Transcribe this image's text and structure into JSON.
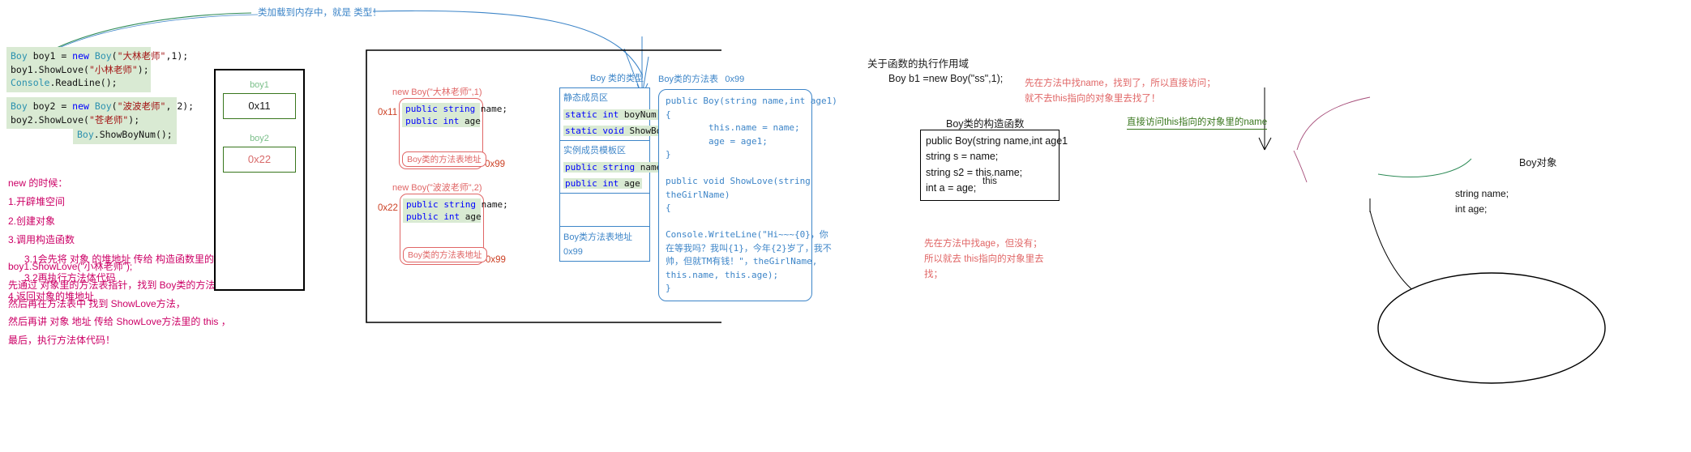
{
  "top_annotation": "类加载到内存中，就是 类型！",
  "left_code": {
    "block1": [
      {
        "parts": [
          {
            "t": "Boy",
            "c": "typ"
          },
          {
            "t": " boy1 = ",
            "c": "pl"
          },
          {
            "t": "new",
            "c": "kw"
          },
          {
            "t": " ",
            "c": "pl"
          },
          {
            "t": "Boy",
            "c": "typ"
          },
          {
            "t": "(",
            "c": "pl"
          },
          {
            "t": "\"大林老师\"",
            "c": "str"
          },
          {
            "t": ",1);",
            "c": "pl"
          }
        ]
      },
      {
        "parts": [
          {
            "t": "boy1.ShowLove(",
            "c": "pl"
          },
          {
            "t": "\"小林老师\"",
            "c": "str"
          },
          {
            "t": ");",
            "c": "pl"
          }
        ]
      },
      {
        "parts": [
          {
            "t": "",
            "c": "pl"
          }
        ]
      },
      {
        "parts": [
          {
            "t": "Console",
            "c": "typ"
          },
          {
            "t": ".ReadLine();",
            "c": "pl"
          }
        ]
      }
    ],
    "block2": [
      {
        "parts": [
          {
            "t": "Boy",
            "c": "typ"
          },
          {
            "t": " boy2 = ",
            "c": "pl"
          },
          {
            "t": "new",
            "c": "kw"
          },
          {
            "t": " ",
            "c": "pl"
          },
          {
            "t": "Boy",
            "c": "typ"
          },
          {
            "t": "(",
            "c": "pl"
          },
          {
            "t": "\"波波老师\"",
            "c": "str"
          },
          {
            "t": ", 2);",
            "c": "pl"
          }
        ]
      },
      {
        "parts": [
          {
            "t": "boy2.ShowLove(",
            "c": "pl"
          },
          {
            "t": "\"苍老师\"",
            "c": "str"
          },
          {
            "t": ");",
            "c": "pl"
          }
        ]
      }
    ],
    "block3": [
      {
        "parts": [
          {
            "t": "Boy",
            "c": "typ"
          },
          {
            "t": ".ShowBoyNum();",
            "c": "pl"
          }
        ]
      }
    ]
  },
  "notes_new": [
    {
      "text": "new 的时候：",
      "indent": false
    },
    {
      "text": "1.开辟堆空间",
      "indent": false
    },
    {
      "text": "2.创建对象",
      "indent": false
    },
    {
      "text": "3.调用构造函数",
      "indent": false
    },
    {
      "text": "3.1会先将 对象 的堆地址 传给 构造函数里的this",
      "indent": true
    },
    {
      "text": "3.2再执行方法体代码",
      "indent": true
    },
    {
      "text": "4.返回对象的堆地址",
      "indent": false
    }
  ],
  "notes_call": [
    "boy1.ShowLove(\"小林老师\");",
    " 先通过 对象里的方法表指针，找到 Boy类的方法表",
    "  然后再在方法表中 找到 ShowLove方法，",
    "  然后再讲 对象 地址 传给 ShowLove方法里的 this ，",
    "  最后，执行方法体代码！"
  ],
  "stack": {
    "slots": [
      {
        "label": "boy1",
        "value": "0x11",
        "style": "dark"
      },
      {
        "label": "boy2",
        "value": "0x22",
        "style": "red"
      }
    ]
  },
  "heap_objects": [
    {
      "caption": "new Boy(\"大林老师\",1)",
      "address": "0x11",
      "fields": [
        {
          "parts": [
            {
              "t": "public",
              "c": "kw"
            },
            {
              "t": " ",
              "c": "pl"
            },
            {
              "t": "string",
              "c": "kw"
            },
            {
              "t": " name;",
              "c": "pl"
            }
          ]
        },
        {
          "parts": [
            {
              "t": "public",
              "c": "kw"
            },
            {
              "t": " ",
              "c": "pl"
            },
            {
              "t": "int",
              "c": "kw"
            },
            {
              "t": " age",
              "c": "pl"
            }
          ]
        }
      ],
      "footer": "Boy类的方法表地址",
      "footer_addr": "0x99"
    },
    {
      "caption": "new Boy(\"波波老师\",2)",
      "address": "0x22",
      "fields": [
        {
          "parts": [
            {
              "t": "public",
              "c": "kw"
            },
            {
              "t": " ",
              "c": "pl"
            },
            {
              "t": "string",
              "c": "kw"
            },
            {
              "t": " name;",
              "c": "pl"
            }
          ]
        },
        {
          "parts": [
            {
              "t": "public",
              "c": "kw"
            },
            {
              "t": " ",
              "c": "pl"
            },
            {
              "t": "int",
              "c": "kw"
            },
            {
              "t": " age",
              "c": "pl"
            }
          ]
        }
      ],
      "footer": "Boy类的方法表地址",
      "footer_addr": "0x99"
    }
  ],
  "class_type": {
    "caption": "Boy 类的类型",
    "static_label": "静态成员区",
    "static_rows": [
      {
        "parts": [
          {
            "t": "static",
            "c": "kw"
          },
          {
            "t": " ",
            "c": "pl"
          },
          {
            "t": "int",
            "c": "kw"
          },
          {
            "t": " boyNum",
            "c": "pl"
          }
        ]
      },
      {
        "parts": [
          {
            "t": "static",
            "c": "kw"
          },
          {
            "t": " ",
            "c": "pl"
          },
          {
            "t": "void",
            "c": "kw"
          },
          {
            "t": " ShowBoyNum()",
            "c": "pl"
          }
        ]
      }
    ],
    "instance_label": "实例成员模板区",
    "instance_rows": [
      {
        "parts": [
          {
            "t": "public",
            "c": "kw"
          },
          {
            "t": " ",
            "c": "pl"
          },
          {
            "t": "string",
            "c": "kw"
          },
          {
            "t": " name;",
            "c": "pl"
          }
        ]
      },
      {
        "parts": [
          {
            "t": "public",
            "c": "kw"
          },
          {
            "t": " ",
            "c": "pl"
          },
          {
            "t": "int",
            "c": "kw"
          },
          {
            "t": " age",
            "c": "pl"
          }
        ]
      }
    ],
    "footer": "Boy类方法表地址",
    "footer_addr": "0x99"
  },
  "method_table": {
    "caption": "Boy类的方法表",
    "address": "0x99",
    "code": "public Boy(string name,int age1)\n{\n        this.name = name;\n        age = age1;\n}\n\npublic void ShowLove(string\ntheGirlName)\n{\n\nConsole.WriteLine(\"Hi~~~{0}，你\n在等我吗？我叫{1}，今年{2}岁了，我不\n帅，但就TM有钱！\"，theGirlName,\nthis.name, this.age);\n}"
  },
  "scope": {
    "title": "关于函数的执行作用域",
    "decl": "Boy b1 =new Boy(\"ss\",1);",
    "ctor_caption": "Boy类的构造函数",
    "ctor_lines": [
      "public Boy(string name,int age1",
      " string s = name;",
      " string s2 = this.name;",
      " int a = age;"
    ],
    "this_label": "this",
    "note_top": [
      "先在方法中找name，找到了，所以直接访问；",
      "就不去this指向的对象里去找了！"
    ],
    "note_bottom": [
      "先在方法中找age，但没有；",
      "所以就去 this指向的对象里去",
      "找；"
    ],
    "green_note": "直接访问this指向的对象里的name",
    "object_caption": "Boy对象",
    "object_fields": [
      "string name;",
      "int age;"
    ]
  }
}
